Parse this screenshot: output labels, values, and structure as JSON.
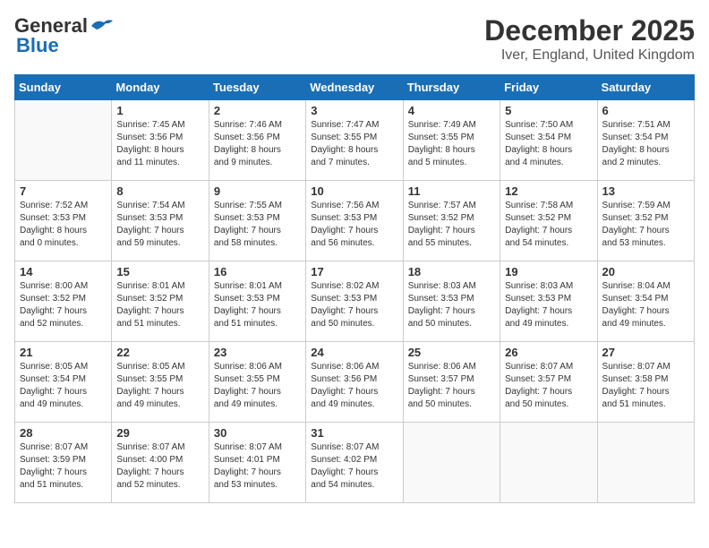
{
  "header": {
    "logo_general": "General",
    "logo_blue": "Blue",
    "month_title": "December 2025",
    "location": "Iver, England, United Kingdom"
  },
  "days_of_week": [
    "Sunday",
    "Monday",
    "Tuesday",
    "Wednesday",
    "Thursday",
    "Friday",
    "Saturday"
  ],
  "weeks": [
    [
      {
        "day": "",
        "info": ""
      },
      {
        "day": "1",
        "info": "Sunrise: 7:45 AM\nSunset: 3:56 PM\nDaylight: 8 hours\nand 11 minutes."
      },
      {
        "day": "2",
        "info": "Sunrise: 7:46 AM\nSunset: 3:56 PM\nDaylight: 8 hours\nand 9 minutes."
      },
      {
        "day": "3",
        "info": "Sunrise: 7:47 AM\nSunset: 3:55 PM\nDaylight: 8 hours\nand 7 minutes."
      },
      {
        "day": "4",
        "info": "Sunrise: 7:49 AM\nSunset: 3:55 PM\nDaylight: 8 hours\nand 5 minutes."
      },
      {
        "day": "5",
        "info": "Sunrise: 7:50 AM\nSunset: 3:54 PM\nDaylight: 8 hours\nand 4 minutes."
      },
      {
        "day": "6",
        "info": "Sunrise: 7:51 AM\nSunset: 3:54 PM\nDaylight: 8 hours\nand 2 minutes."
      }
    ],
    [
      {
        "day": "7",
        "info": "Sunrise: 7:52 AM\nSunset: 3:53 PM\nDaylight: 8 hours\nand 0 minutes."
      },
      {
        "day": "8",
        "info": "Sunrise: 7:54 AM\nSunset: 3:53 PM\nDaylight: 7 hours\nand 59 minutes."
      },
      {
        "day": "9",
        "info": "Sunrise: 7:55 AM\nSunset: 3:53 PM\nDaylight: 7 hours\nand 58 minutes."
      },
      {
        "day": "10",
        "info": "Sunrise: 7:56 AM\nSunset: 3:53 PM\nDaylight: 7 hours\nand 56 minutes."
      },
      {
        "day": "11",
        "info": "Sunrise: 7:57 AM\nSunset: 3:52 PM\nDaylight: 7 hours\nand 55 minutes."
      },
      {
        "day": "12",
        "info": "Sunrise: 7:58 AM\nSunset: 3:52 PM\nDaylight: 7 hours\nand 54 minutes."
      },
      {
        "day": "13",
        "info": "Sunrise: 7:59 AM\nSunset: 3:52 PM\nDaylight: 7 hours\nand 53 minutes."
      }
    ],
    [
      {
        "day": "14",
        "info": "Sunrise: 8:00 AM\nSunset: 3:52 PM\nDaylight: 7 hours\nand 52 minutes."
      },
      {
        "day": "15",
        "info": "Sunrise: 8:01 AM\nSunset: 3:52 PM\nDaylight: 7 hours\nand 51 minutes."
      },
      {
        "day": "16",
        "info": "Sunrise: 8:01 AM\nSunset: 3:53 PM\nDaylight: 7 hours\nand 51 minutes."
      },
      {
        "day": "17",
        "info": "Sunrise: 8:02 AM\nSunset: 3:53 PM\nDaylight: 7 hours\nand 50 minutes."
      },
      {
        "day": "18",
        "info": "Sunrise: 8:03 AM\nSunset: 3:53 PM\nDaylight: 7 hours\nand 50 minutes."
      },
      {
        "day": "19",
        "info": "Sunrise: 8:03 AM\nSunset: 3:53 PM\nDaylight: 7 hours\nand 49 minutes."
      },
      {
        "day": "20",
        "info": "Sunrise: 8:04 AM\nSunset: 3:54 PM\nDaylight: 7 hours\nand 49 minutes."
      }
    ],
    [
      {
        "day": "21",
        "info": "Sunrise: 8:05 AM\nSunset: 3:54 PM\nDaylight: 7 hours\nand 49 minutes."
      },
      {
        "day": "22",
        "info": "Sunrise: 8:05 AM\nSunset: 3:55 PM\nDaylight: 7 hours\nand 49 minutes."
      },
      {
        "day": "23",
        "info": "Sunrise: 8:06 AM\nSunset: 3:55 PM\nDaylight: 7 hours\nand 49 minutes."
      },
      {
        "day": "24",
        "info": "Sunrise: 8:06 AM\nSunset: 3:56 PM\nDaylight: 7 hours\nand 49 minutes."
      },
      {
        "day": "25",
        "info": "Sunrise: 8:06 AM\nSunset: 3:57 PM\nDaylight: 7 hours\nand 50 minutes."
      },
      {
        "day": "26",
        "info": "Sunrise: 8:07 AM\nSunset: 3:57 PM\nDaylight: 7 hours\nand 50 minutes."
      },
      {
        "day": "27",
        "info": "Sunrise: 8:07 AM\nSunset: 3:58 PM\nDaylight: 7 hours\nand 51 minutes."
      }
    ],
    [
      {
        "day": "28",
        "info": "Sunrise: 8:07 AM\nSunset: 3:59 PM\nDaylight: 7 hours\nand 51 minutes."
      },
      {
        "day": "29",
        "info": "Sunrise: 8:07 AM\nSunset: 4:00 PM\nDaylight: 7 hours\nand 52 minutes."
      },
      {
        "day": "30",
        "info": "Sunrise: 8:07 AM\nSunset: 4:01 PM\nDaylight: 7 hours\nand 53 minutes."
      },
      {
        "day": "31",
        "info": "Sunrise: 8:07 AM\nSunset: 4:02 PM\nDaylight: 7 hours\nand 54 minutes."
      },
      {
        "day": "",
        "info": ""
      },
      {
        "day": "",
        "info": ""
      },
      {
        "day": "",
        "info": ""
      }
    ]
  ]
}
